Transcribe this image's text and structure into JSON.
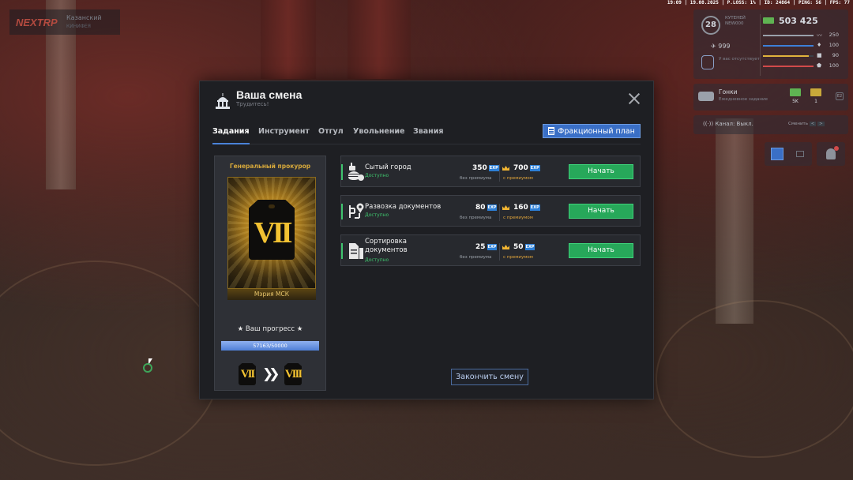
{
  "hud": {
    "server_brand": "NEXTRP",
    "server_name": "Казанский",
    "server_sub": "КИНИФЕЯ",
    "topbar": "19:09 | 19.08.2025 | P.LOSS: 1% | ID: 24864 | PING: 56 | FPS: 77",
    "level": "28",
    "player_name": "КУТЕНЕЙ",
    "player_id": "NEW000",
    "money": "503 425",
    "count_999": "999",
    "badge_text": "У вас отсутствует",
    "stats": [
      {
        "name": "health",
        "value": "250",
        "fill": 1.0,
        "color": "#9aa0aa",
        "icon": "heartbeat-icon"
      },
      {
        "name": "hunger",
        "value": "100",
        "fill": 1.0,
        "color": "#3c7fd8",
        "icon": "drop-icon"
      },
      {
        "name": "armor",
        "value": "90",
        "fill": 0.9,
        "color": "#e0b23c",
        "icon": "food-icon"
      },
      {
        "name": "stamina",
        "value": "100",
        "fill": 1.0,
        "color": "#d14a4a",
        "icon": "shield-icon"
      }
    ],
    "race": {
      "title": "Гонки",
      "subtitle": "Ежедневное задание",
      "prize_1": "5K",
      "prize_2": "1",
      "key": "E2"
    },
    "voice": {
      "label": "Канал: Выкл.",
      "change": "Сменить",
      "key_1": "<",
      "key_2": ">"
    }
  },
  "modal": {
    "title": "Ваша смена",
    "subtitle": "Трудитесь!",
    "tabs": [
      "Задания",
      "Инструмент",
      "Отгул",
      "Увольнение",
      "Звания"
    ],
    "active_tab": 0,
    "faction_plan_label": "Фракционный план",
    "rank": {
      "title": "Генеральный прокурор",
      "numeral": "VII",
      "organization": "Мэрия МСК",
      "progress_label": "★ Ваш прогресс ★",
      "progress_text": "57163/50000",
      "progress_fraction": 1.0,
      "current_numeral": "VII",
      "next_numeral": "VIII"
    },
    "tasks": [
      {
        "name": "Сытый город",
        "status": "Доступно",
        "xp_base": "350",
        "xp_base_label": "без премиума",
        "xp_premium": "700",
        "xp_premium_label": "с премиумом",
        "xp_unit": "EXP",
        "button": "Начать",
        "icon": "burger-icon"
      },
      {
        "name": "Развозка документов",
        "status": "Доступно",
        "xp_base": "80",
        "xp_base_label": "без премиума",
        "xp_premium": "160",
        "xp_premium_label": "с премиумом",
        "xp_unit": "EXP",
        "button": "Начать",
        "icon": "route-icon"
      },
      {
        "name": "Сортировка документов",
        "status": "Доступно",
        "xp_base": "25",
        "xp_base_label": "без премиума",
        "xp_premium": "50",
        "xp_premium_label": "с премиумом",
        "xp_unit": "EXP",
        "button": "Начать",
        "icon": "documents-icon"
      }
    ],
    "finish_label": "Закончить смену"
  }
}
